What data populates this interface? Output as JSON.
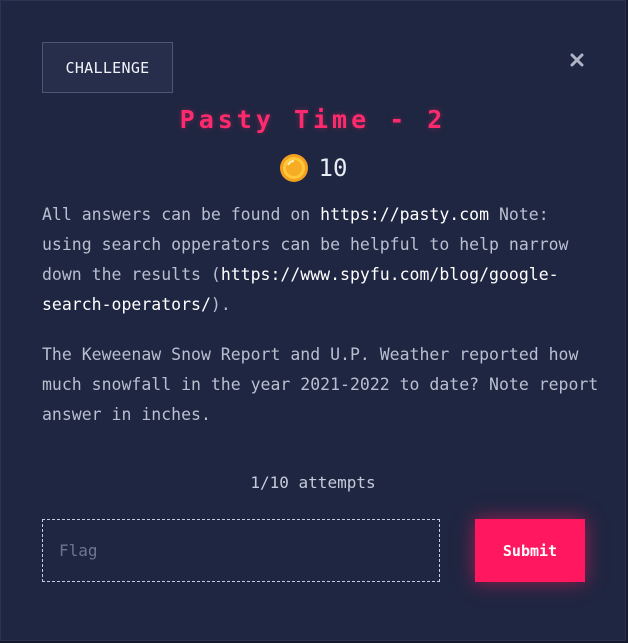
{
  "modal": {
    "tab_label": "CHALLENGE",
    "close_icon": "close-icon",
    "title": "Pasty Time - 2",
    "coin_icon": "coin-icon",
    "points": "10",
    "description": {
      "p1_a": "All answers can be found on ",
      "p1_link1": "https://pasty.com",
      "p1_b": " Note: using search opperators can be helpful to help narrow down the results (",
      "p1_link2": "https://www.spyfu.com/blog/google-search-operators/",
      "p1_c": ").",
      "p2": "The Keweenaw Snow Report and U.P. Weather reported how much snowfall in the year 2021-2022 to date? Note report answer in inches."
    },
    "attempts": "1/10 attempts",
    "flag_placeholder": "Flag",
    "submit_label": "Submit"
  },
  "colors": {
    "background": "#1f2641",
    "accent": "#ff1760",
    "title": "#ff2a6d"
  }
}
